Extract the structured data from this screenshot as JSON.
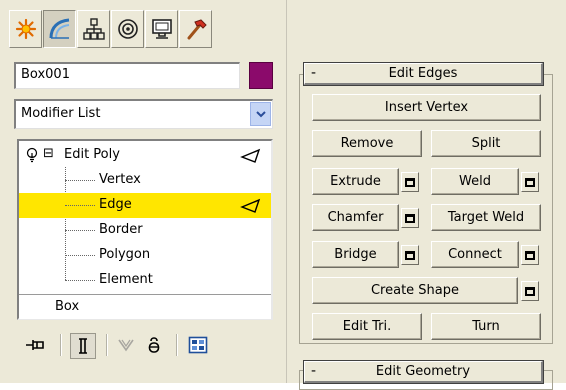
{
  "tabs": [
    {
      "icon": "create-star-icon",
      "active": false
    },
    {
      "icon": "modify-curve-icon",
      "active": true
    },
    {
      "icon": "hierarchy-icon",
      "active": false
    },
    {
      "icon": "motion-icon",
      "active": false
    },
    {
      "icon": "display-monitor-icon",
      "active": false
    },
    {
      "icon": "utilities-hammer-icon",
      "active": false
    }
  ],
  "object": {
    "name": "Box001",
    "color": "#8b0a6b"
  },
  "modifier_list": {
    "selected": "Modifier List"
  },
  "stack": {
    "top": {
      "label": "Edit Poly",
      "expand": "⊟"
    },
    "subobjects": [
      {
        "label": "Vertex",
        "selected": false
      },
      {
        "label": "Edge",
        "selected": true
      },
      {
        "label": "Border",
        "selected": false
      },
      {
        "label": "Polygon",
        "selected": false
      },
      {
        "label": "Element",
        "selected": false
      }
    ],
    "base": "Box"
  },
  "colors": {
    "selection_highlight": "#ffe600",
    "panel_bg": "#ece9d8"
  },
  "edit_edges": {
    "toggle": "-",
    "title": "Edit Edges",
    "insert_vertex": "Insert Vertex",
    "remove": "Remove",
    "split": "Split",
    "extrude": "Extrude",
    "weld": "Weld",
    "chamfer": "Chamfer",
    "target_weld": "Target Weld",
    "bridge": "Bridge",
    "connect": "Connect",
    "create_shape": "Create Shape",
    "edit_tri": "Edit Tri.",
    "turn": "Turn"
  },
  "edit_geometry": {
    "toggle": "-",
    "title": "Edit Geometry"
  }
}
